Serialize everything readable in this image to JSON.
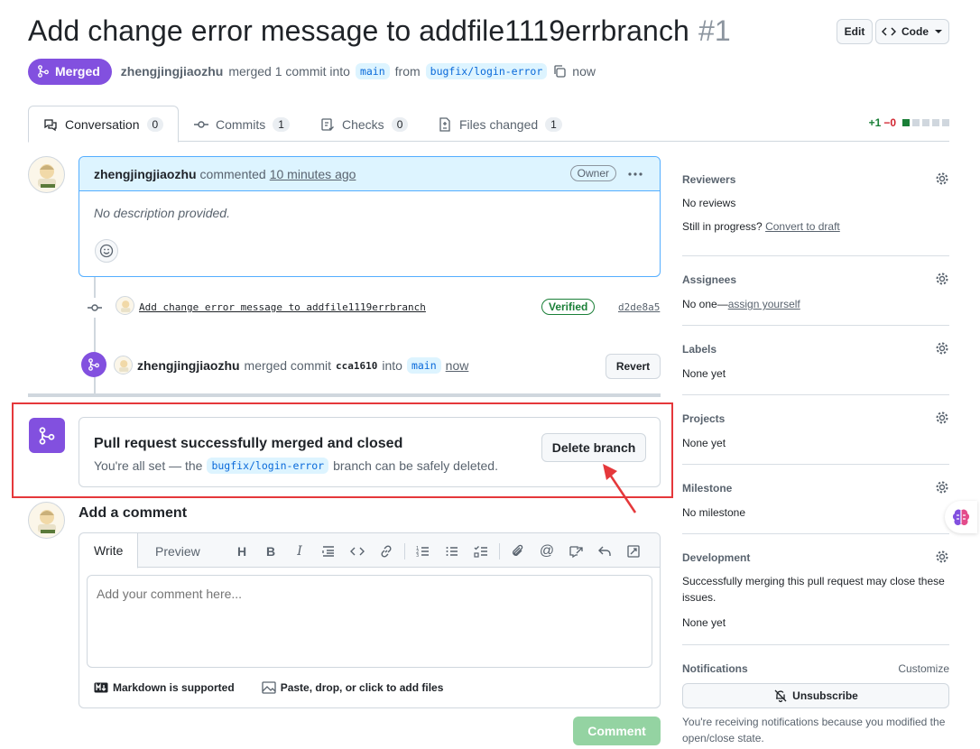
{
  "header": {
    "title": "Add change error message to addfile1119errbranch",
    "number": "#1",
    "edit_label": "Edit",
    "code_label": "Code"
  },
  "meta": {
    "status": "Merged",
    "author": "zhengjingjiaozhu",
    "action": "merged 1 commit into",
    "base_branch": "main",
    "from": "from",
    "head_branch": "bugfix/login-error",
    "time": "now"
  },
  "tabs": [
    {
      "label": "Conversation",
      "count": "0"
    },
    {
      "label": "Commits",
      "count": "1"
    },
    {
      "label": "Checks",
      "count": "0"
    },
    {
      "label": "Files changed",
      "count": "1"
    }
  ],
  "diffstat": {
    "added": "+1",
    "removed": "−0"
  },
  "comment": {
    "author": "zhengjingjiaozhu",
    "verb": "commented",
    "time": "10 minutes ago",
    "badge": "Owner",
    "body": "No description provided."
  },
  "commit": {
    "message": "Add change error message to addfile1119errbranch",
    "verified": "Verified",
    "sha": "d2de8a5"
  },
  "merge_event": {
    "author": "zhengjingjiaozhu",
    "verb": "merged commit",
    "sha": "cca1610",
    "into": "into",
    "branch": "main",
    "time": "now",
    "revert_label": "Revert"
  },
  "merged_box": {
    "title": "Pull request successfully merged and closed",
    "sub_prefix": "You're all set — the",
    "branch": "bugfix/login-error",
    "sub_suffix": "branch can be safely deleted.",
    "delete_label": "Delete branch"
  },
  "add_comment": {
    "title": "Add a comment",
    "write_tab": "Write",
    "preview_tab": "Preview",
    "placeholder": "Add your comment here...",
    "markdown_note": "Markdown is supported",
    "files_note": "Paste, drop, or click to add files",
    "submit_label": "Comment"
  },
  "sidebar": {
    "reviewers": {
      "label": "Reviewers",
      "value": "No reviews",
      "progress_prefix": "Still in progress?",
      "progress_link": "Convert to draft"
    },
    "assignees": {
      "label": "Assignees",
      "value_prefix": "No one—",
      "value_link": "assign yourself"
    },
    "labels": {
      "label": "Labels",
      "value": "None yet"
    },
    "projects": {
      "label": "Projects",
      "value": "None yet"
    },
    "milestone": {
      "label": "Milestone",
      "value": "No milestone"
    },
    "development": {
      "label": "Development",
      "note": "Successfully merging this pull request may close these issues.",
      "value": "None yet"
    },
    "notifications": {
      "label": "Notifications",
      "customize": "Customize",
      "unsubscribe_label": "Unsubscribe",
      "note": "You're receiving notifications because you modified the open/close state."
    }
  },
  "colors": {
    "merged": "#8250df",
    "accent": "#0969da",
    "success": "#1a7f37",
    "highlight": "#e5383b"
  }
}
